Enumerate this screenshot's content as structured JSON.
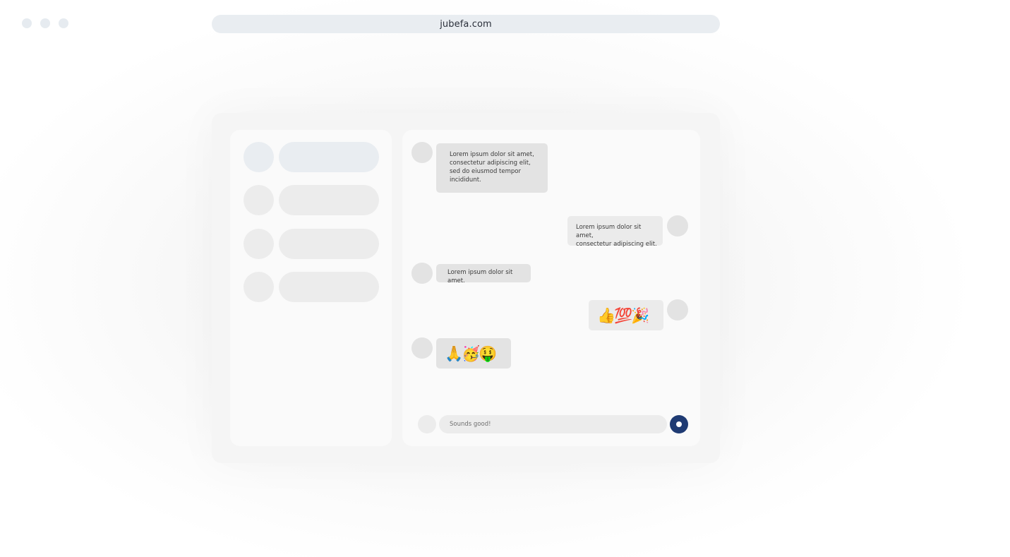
{
  "browser": {
    "url": "jubefa.com"
  },
  "sidebar": {
    "contacts": [
      {
        "state": "active"
      },
      {
        "state": "idle"
      },
      {
        "state": "idle"
      },
      {
        "state": "idle"
      }
    ]
  },
  "chat": {
    "messages": [
      {
        "direction": "incoming",
        "text": "Lorem ipsum dolor sit amet,\nconsectetur adipiscing elit,\nsed do eiusmod tempor\nincididunt."
      },
      {
        "direction": "outgoing",
        "text": "Lorem ipsum dolor sit amet,\nconsectetur adipiscing elit."
      },
      {
        "direction": "incoming",
        "text": "Lorem ipsum dolor sit amet."
      },
      {
        "direction": "outgoing",
        "text": "👍💯🎉"
      },
      {
        "direction": "incoming",
        "text": "🙏🥳🤑"
      }
    ],
    "composer": {
      "value": "Sounds good!"
    }
  },
  "colors": {
    "accent": "#1f3b73",
    "bubble_incoming": "#e3e3e3",
    "bubble_outgoing": "#ebebeb",
    "panel": "#fafafa",
    "active_contact": "#e9edf1"
  },
  "icons": {
    "send": "send-icon"
  }
}
